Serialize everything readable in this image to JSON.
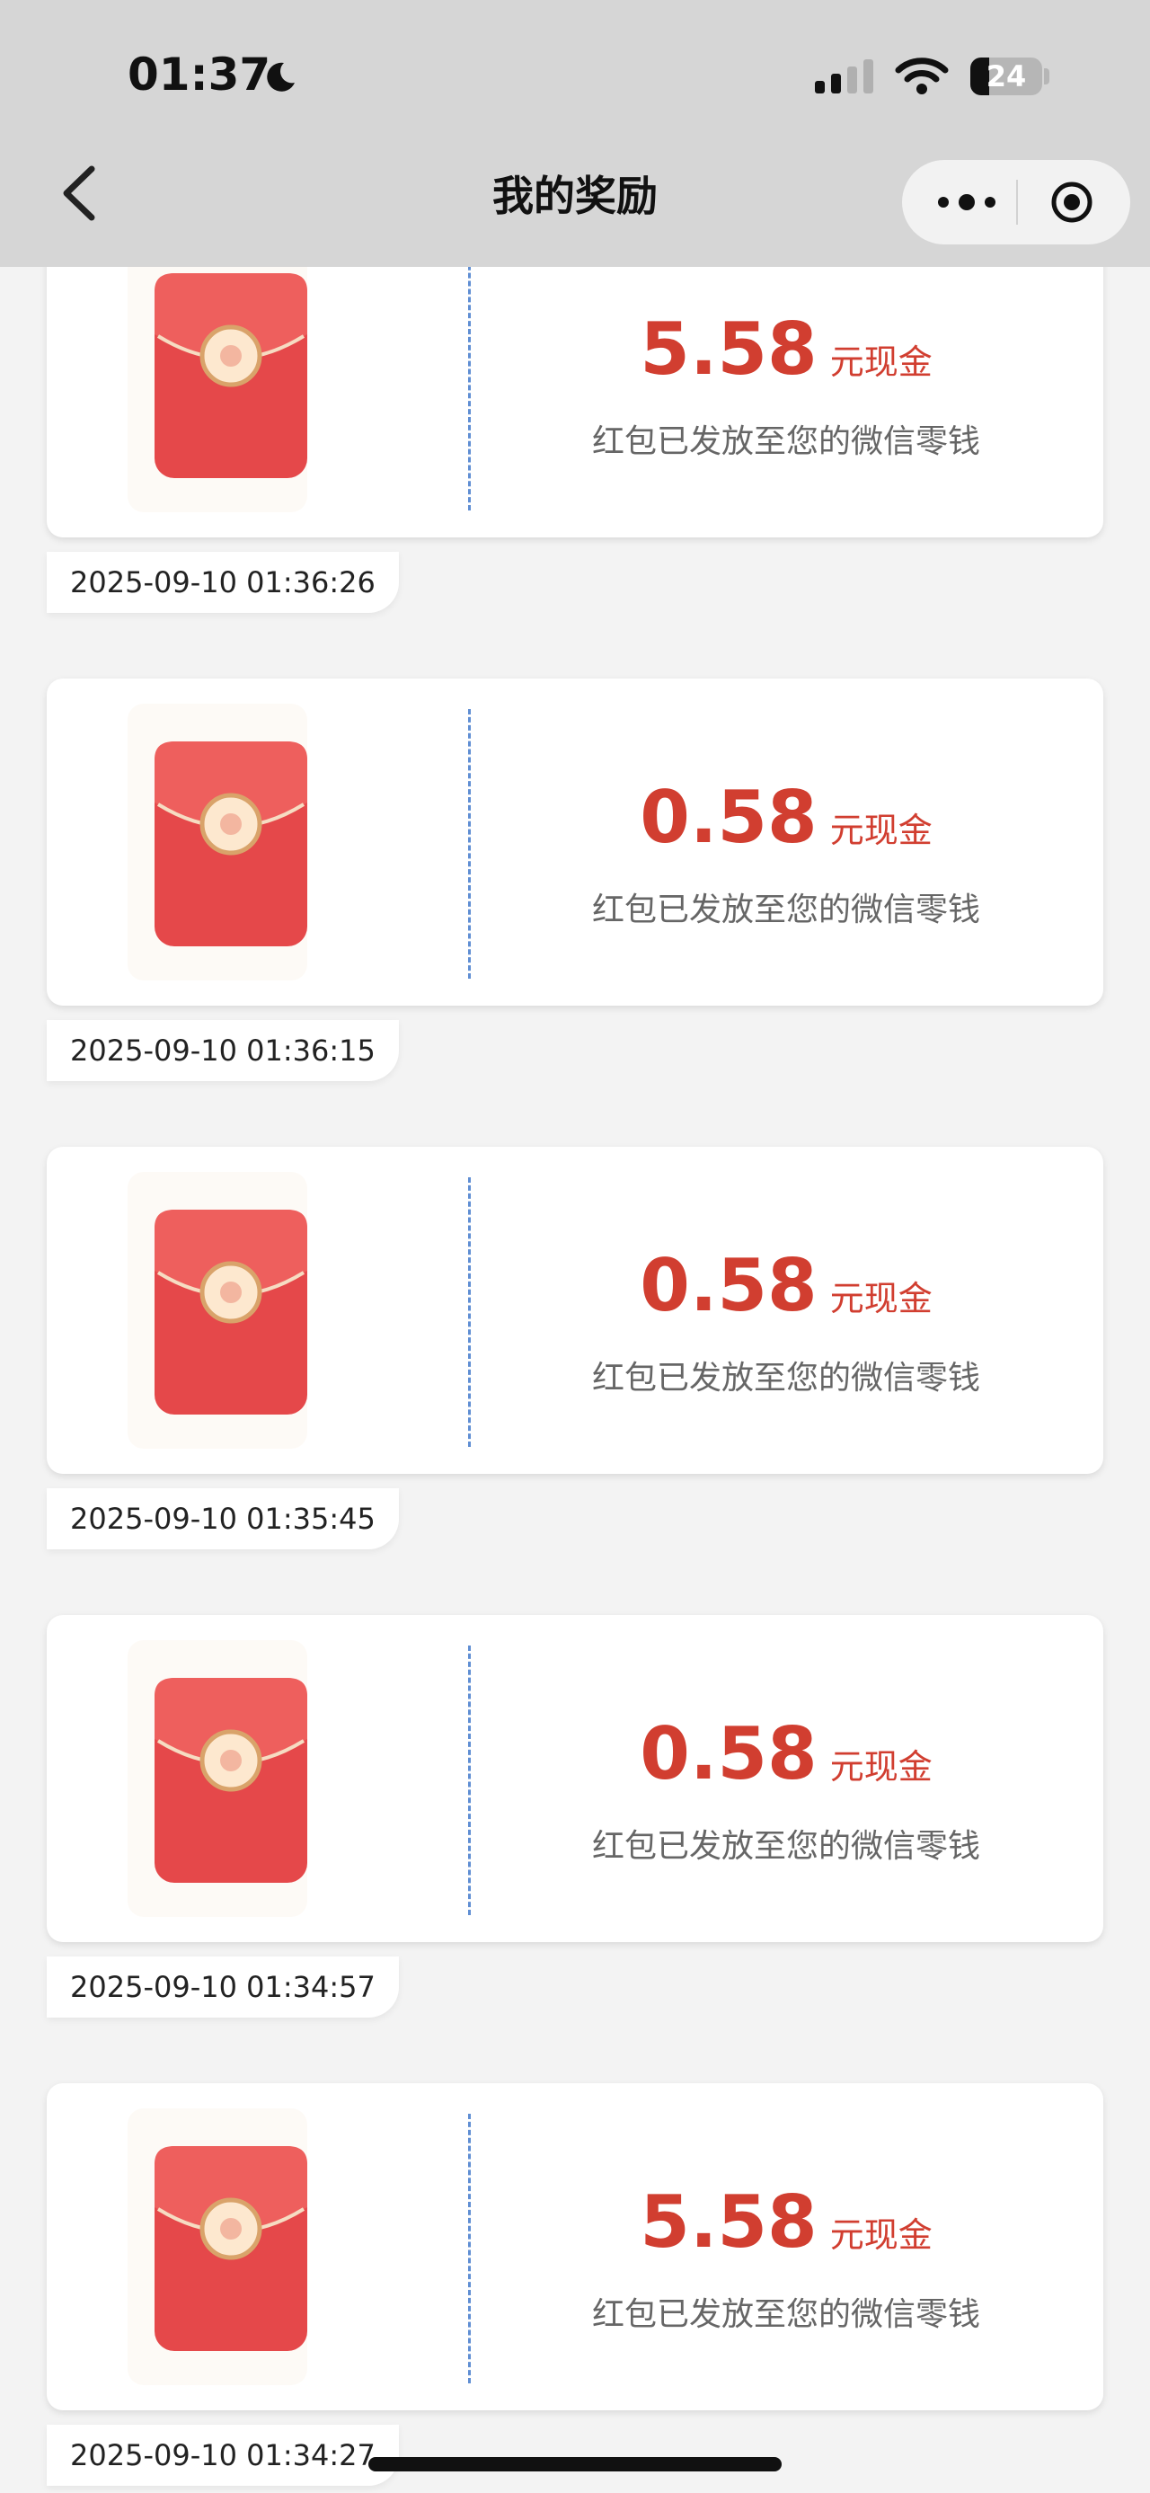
{
  "status_bar": {
    "time": "01:37",
    "battery": "24"
  },
  "nav": {
    "title": "我的奖励"
  },
  "rewards": [
    {
      "amount": "5.58",
      "unit": "元现金",
      "note": "红包已发放至您的微信零钱",
      "timestamp": "2025-09-10 01:36:26"
    },
    {
      "amount": "0.58",
      "unit": "元现金",
      "note": "红包已发放至您的微信零钱",
      "timestamp": "2025-09-10 01:36:15"
    },
    {
      "amount": "0.58",
      "unit": "元现金",
      "note": "红包已发放至您的微信零钱",
      "timestamp": "2025-09-10 01:35:45"
    },
    {
      "amount": "0.58",
      "unit": "元现金",
      "note": "红包已发放至您的微信零钱",
      "timestamp": "2025-09-10 01:34:57"
    },
    {
      "amount": "5.58",
      "unit": "元现金",
      "note": "红包已发放至您的微信零钱",
      "timestamp": "2025-09-10 01:34:27"
    }
  ],
  "colors": {
    "accent": "#d13e30",
    "header_bg": "#d6d6d6",
    "page_bg": "#f3f3f3",
    "divider": "#5f8ed3"
  },
  "icons": [
    "moon-icon",
    "signal-icon",
    "wifi-icon",
    "battery-icon",
    "back-chevron-icon",
    "more-icon",
    "close-target-icon",
    "red-envelope-icon"
  ]
}
